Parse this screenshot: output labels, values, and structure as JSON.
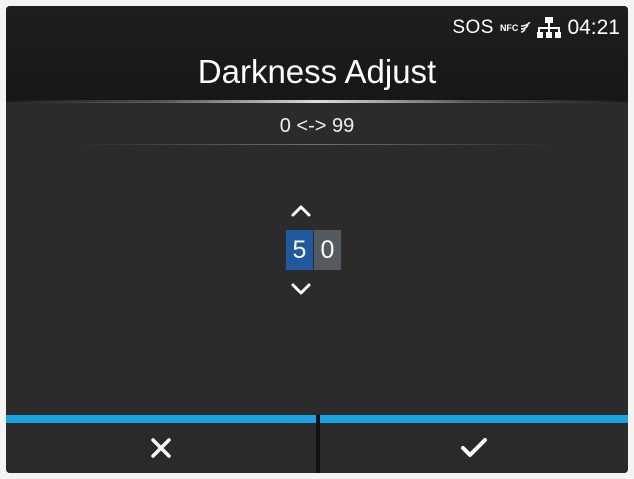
{
  "status": {
    "sos_label": "SOS",
    "nfc_label": "NFC",
    "network_icon": "network-icon",
    "time": "04:21"
  },
  "header": {
    "title": "Darkness Adjust"
  },
  "range": {
    "label": "0 <-> 99"
  },
  "stepper": {
    "digits": [
      "5",
      "0"
    ],
    "active_digit_index": 0,
    "up_icon": "chevron-up-icon",
    "down_icon": "chevron-down-icon"
  },
  "buttons": {
    "cancel_icon": "close-icon",
    "confirm_icon": "checkmark-icon"
  },
  "colors": {
    "accent": "#1aa3e3",
    "active_digit": "#1f5aa1",
    "inactive_digit": "#555a60",
    "background": "#2b2b2b"
  }
}
